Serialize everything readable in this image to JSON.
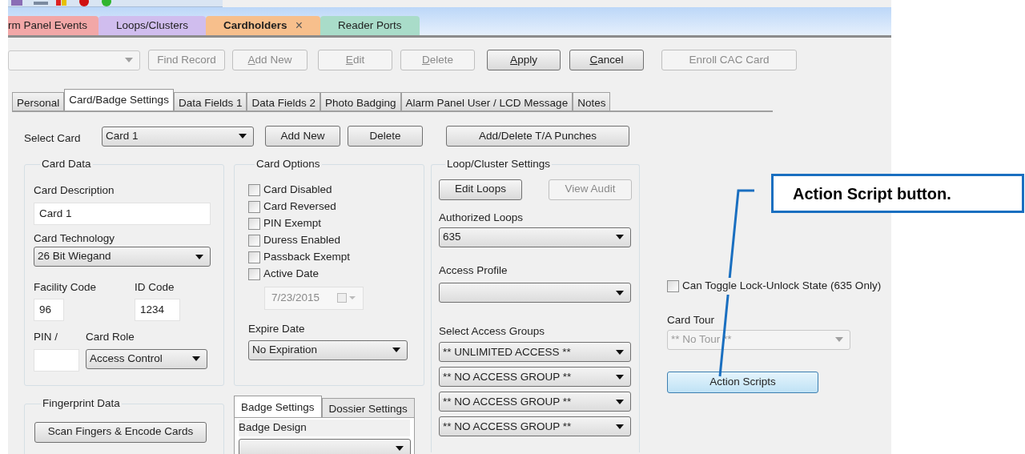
{
  "document_tabs": [
    {
      "label": "rm Panel Events",
      "selected": false,
      "color": "#f2a7a7"
    },
    {
      "label": "Loops/Clusters",
      "selected": false,
      "color": "#d0bdee"
    },
    {
      "label": "Cardholders",
      "selected": true,
      "color": "#f7bf8c",
      "close": "×"
    },
    {
      "label": "Reader Ports",
      "selected": false,
      "color": "#a9dcc9"
    }
  ],
  "record_toolbar": {
    "buttons": [
      {
        "label": "Find Record",
        "disabled": true,
        "access_key": false
      },
      {
        "label": "Add New",
        "disabled": true,
        "access_key": true
      },
      {
        "label": "Edit",
        "disabled": true,
        "access_key": true
      },
      {
        "label": "Delete",
        "disabled": true,
        "access_key": true
      },
      {
        "label": "Apply",
        "disabled": false,
        "access_key": true
      },
      {
        "label": "Cancel",
        "disabled": false,
        "access_key": true
      },
      {
        "label": "Enroll CAC Card",
        "disabled": true,
        "access_key": false
      }
    ]
  },
  "record_tabs": [
    {
      "label": "Personal",
      "selected": false
    },
    {
      "label": "Card/Badge Settings",
      "selected": true
    },
    {
      "label": "Data Fields 1",
      "selected": false
    },
    {
      "label": "Data Fields 2",
      "selected": false
    },
    {
      "label": "Photo Badging",
      "selected": false
    },
    {
      "label": "Alarm Panel User / LCD Message",
      "selected": false
    },
    {
      "label": "Notes",
      "selected": false
    }
  ],
  "select_card": {
    "label": "Select Card",
    "value": "Card 1",
    "buttons": [
      "Add New",
      "Delete",
      "Add/Delete T/A Punches"
    ]
  },
  "card_data": {
    "title": "Card Data",
    "description": {
      "label": "Card Description",
      "value": "Card 1"
    },
    "technology": {
      "label": "Card Technology",
      "value": "26 Bit Wiegand"
    },
    "facility_code": {
      "label": "Facility Code",
      "value": "96"
    },
    "id_code": {
      "label": "ID Code",
      "value": "1234"
    },
    "pin": {
      "label": "PIN /"
    },
    "card_role": {
      "label": "Card Role",
      "value": "Access Control"
    }
  },
  "card_options": {
    "title": "Card Options",
    "checkboxes": [
      {
        "label": "Card Disabled",
        "checked": false
      },
      {
        "label": "Card Reversed",
        "checked": false
      },
      {
        "label": "PIN Exempt",
        "checked": false
      },
      {
        "label": "Duress Enabled",
        "checked": false
      },
      {
        "label": "Passback Exempt",
        "checked": false
      },
      {
        "label": "Active Date",
        "checked": false
      }
    ],
    "active_date": {
      "value": "7/23/2015",
      "disabled": true
    },
    "expire_date": {
      "label": "Expire Date",
      "value": "No Expiration"
    }
  },
  "loop_cluster_settings": {
    "title": "Loop/Cluster Settings",
    "buttons": [
      {
        "label": "Edit Loops",
        "disabled": false
      },
      {
        "label": "View Audit",
        "disabled": true
      }
    ],
    "authorized_loops": {
      "label": "Authorized Loops",
      "value": "635"
    },
    "access_profile": {
      "label": "Access Profile"
    },
    "access_groups": {
      "label": "Select Access Groups",
      "values": [
        "** UNLIMITED ACCESS **",
        "** NO ACCESS GROUP **",
        "** NO ACCESS GROUP **",
        "** NO ACCESS GROUP **"
      ]
    }
  },
  "lock_toggle": {
    "label": "Can Toggle Lock-Unlock State (635 Only)",
    "checked": false
  },
  "card_tour": {
    "label": "Card Tour",
    "value": "** No Tour **",
    "disabled": true
  },
  "action_scripts_button": {
    "label": "Action Scripts",
    "highlighted": true
  },
  "fingerprint_data": {
    "title": "Fingerprint Data",
    "button": "Scan Fingers & Encode Cards"
  },
  "badge_tabs": [
    {
      "label": "Badge Settings",
      "selected": true
    },
    {
      "label": "Dossier Settings",
      "selected": false
    }
  ],
  "badge_design": {
    "label": "Badge Design"
  },
  "callout": {
    "text": "Action Script button."
  }
}
